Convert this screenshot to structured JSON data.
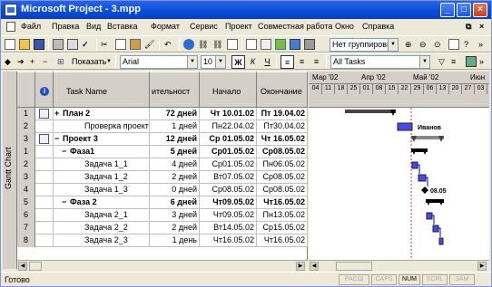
{
  "window": {
    "title": "Microsoft Project - 3.mpp"
  },
  "menu": [
    "Файл",
    "Правка",
    "Вид",
    "Вставка",
    "Формат",
    "Сервис",
    "Проект",
    "Совместная работа",
    "Окно",
    "Справка"
  ],
  "toolbar1": {
    "grouping": "Нет группировки"
  },
  "toolbar2": {
    "show_label": "Показать",
    "font": "Arial",
    "font_size": "10",
    "bold": "Ж",
    "italic": "К",
    "underline": "Ч",
    "filter": "All Tasks"
  },
  "grid": {
    "headers": {
      "info": "i",
      "task_name": "Task Name",
      "duration": "ительност",
      "start": "Начало",
      "finish": "Окончание"
    },
    "rows": [
      {
        "id": "1",
        "icon": true,
        "name": "План 2",
        "expand": "+",
        "duration": "72 дней",
        "start": "Чт 10.01.02",
        "finish": "Пт 19.04.02",
        "bold": true
      },
      {
        "id": "2",
        "name": "Проверка проектных рез",
        "duration": "1 дней",
        "start": "Пн22.04.02",
        "finish": "Пт30.04.02",
        "bold": false
      },
      {
        "id": "3",
        "icon": true,
        "name": "Проект 3",
        "expand": "−",
        "duration": "12 дней",
        "start": "Ср 01.05.02",
        "finish": "Чт 16.05.02",
        "bold": true
      },
      {
        "id": "1",
        "name": "Фаза1",
        "expand": "−",
        "duration": "5 дней",
        "start": "Ср01.05.02",
        "finish": "Ср08.05.02",
        "bold": true
      },
      {
        "id": "2",
        "name": "Задача 1_1",
        "duration": "4 дней",
        "start": "Ср01.05.02",
        "finish": "Пн06.05.02",
        "bold": false
      },
      {
        "id": "3",
        "name": "Задача 1_2",
        "duration": "2 дней",
        "start": "Вт07.05.02",
        "finish": "Ср08.05.02",
        "bold": false
      },
      {
        "id": "4",
        "name": "Задача 1_3",
        "duration": "0 дней",
        "start": "Ср08.05.02",
        "finish": "Ср08.05.02",
        "bold": false
      },
      {
        "id": "5",
        "name": "Фаза 2",
        "expand": "−",
        "duration": "6 дней",
        "start": "Чт09.05.02",
        "finish": "Чт16.05.02",
        "bold": true
      },
      {
        "id": "6",
        "name": "Задача 2_1",
        "duration": "3 дней",
        "start": "Чт09.05.02",
        "finish": "Пн13.05.02",
        "bold": false
      },
      {
        "id": "7",
        "name": "Задача 2_2",
        "duration": "2 дней",
        "start": "Вт14.05.02",
        "finish": "Ср15.05.02",
        "bold": false
      },
      {
        "id": "8",
        "name": "Задача 2_3",
        "duration": "1 день",
        "start": "Чт16.05.02",
        "finish": "Чт16.05.02",
        "bold": false
      }
    ]
  },
  "gantt": {
    "months": [
      "Мар '02",
      "Апр '02",
      "Май '02",
      "Июн"
    ],
    "days": [
      "04",
      "11",
      "18",
      "25",
      "01",
      "08",
      "15",
      "22",
      "29",
      "06",
      "13",
      "20",
      "27",
      "03"
    ],
    "labels": {
      "review": "Иванов",
      "milestone": "08.05"
    }
  },
  "side_label": "Gantt Chart",
  "status": {
    "ready": "Готово",
    "indicators": [
      "РАСШ",
      "CAPS",
      "NUM",
      "SCRL",
      "ЗАМ"
    ],
    "active": "NUM"
  }
}
